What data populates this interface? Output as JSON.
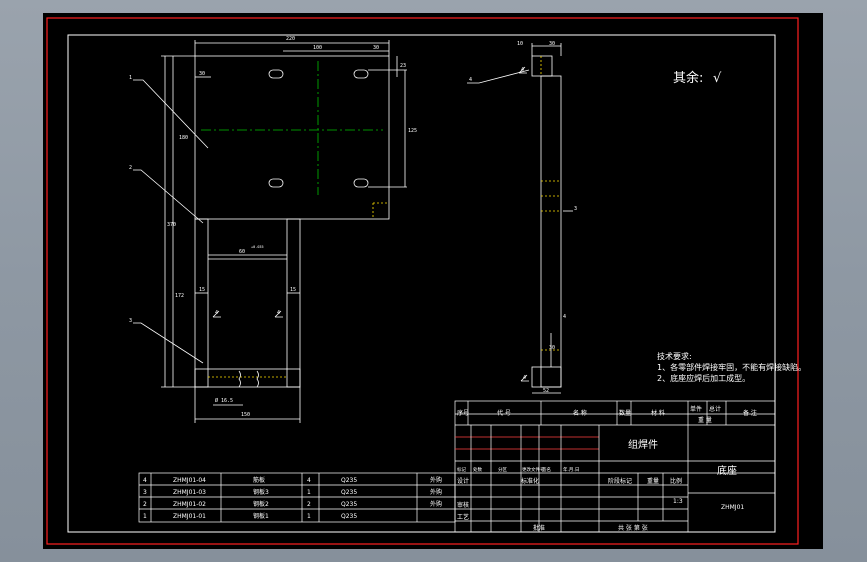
{
  "roughness": {
    "label": "其余:",
    "symbol": "√"
  },
  "tech_requirements": {
    "title": "技术要求:",
    "lines": [
      "1、各零部件焊接牢固，不能有焊接缺陷。",
      "2、底座应焊后加工成型。"
    ]
  },
  "front_view": {
    "dims": {
      "top_total": "220",
      "top_spacing": "100",
      "top_right": "30",
      "left_offset": "30",
      "right_small": "23",
      "plate_height": "180",
      "hole_spacing": "125",
      "total_height": "370",
      "lower_height": "172",
      "slot_width": "60",
      "slot_tol": "+0.035",
      "left_wall": "15",
      "right_wall": "15",
      "hole_dia": "Ø 16.5",
      "bottom_width": "150",
      "weld_left": "4",
      "weld_right": "4"
    },
    "leaders": [
      "1",
      "2",
      "3"
    ]
  },
  "side_view": {
    "dims": {
      "top_left": "10",
      "top_right": "30",
      "mid": "3",
      "lower": "30",
      "bottom": "52",
      "weld_top": "4",
      "weld_mid": "4",
      "weld_bottom": "4"
    },
    "leaders": [
      "4"
    ]
  },
  "title_block": {
    "header": {
      "seq": "序号",
      "code": "代 号",
      "name": "名 称",
      "qty": "数量",
      "material": "材 料",
      "unit_wt": "单件",
      "total_wt": "总计",
      "weight": "重 量",
      "remark": "备 注"
    },
    "assembly_title": "组焊件",
    "part_name": "底座",
    "drawing_no": "ZHMJ01",
    "change_row": [
      "标记",
      "处数",
      "分区",
      "更改文件号",
      "签名",
      "年.月.日"
    ],
    "sign_rows": [
      "设计",
      "审核",
      "工艺"
    ],
    "standardize": "标准化",
    "approve": "批准",
    "stage_marks": "阶段标记",
    "weight_label": "重量",
    "scale_label": "比例",
    "scale": "1:3",
    "sheets": "共 张 第 张"
  },
  "bom": [
    {
      "seq": "4",
      "code": "ZHMJ01-04",
      "name": "筋板",
      "qty": "4",
      "material": "Q235",
      "remark": "外购"
    },
    {
      "seq": "3",
      "code": "ZHMJ01-03",
      "name": "钢板3",
      "qty": "1",
      "material": "Q235",
      "remark": "外购"
    },
    {
      "seq": "2",
      "code": "ZHMJ01-02",
      "name": "钢板2",
      "qty": "2",
      "material": "Q235",
      "remark": "外购"
    },
    {
      "seq": "1",
      "code": "ZHMJ01-01",
      "name": "钢板1",
      "qty": "1",
      "material": "Q235",
      "remark": ""
    }
  ]
}
